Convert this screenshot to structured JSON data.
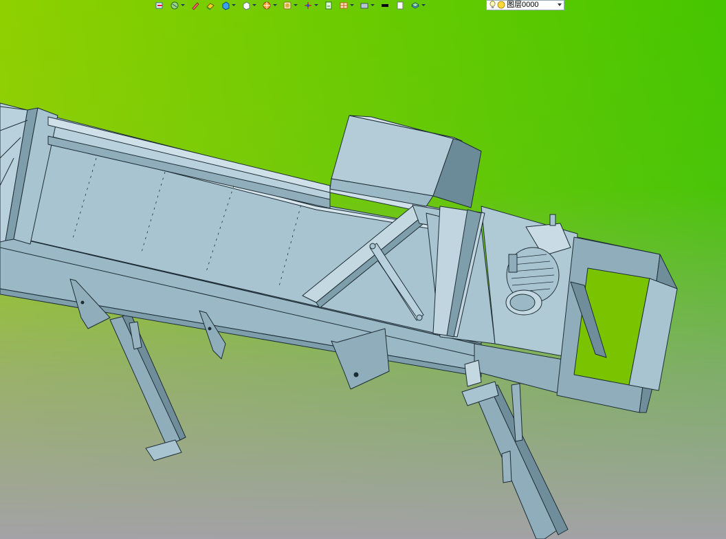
{
  "background": {
    "top_left": "#8fd400",
    "top_right": "#3fc400",
    "bottom": "#a4a3a7",
    "model_fill": "#a8c4d0",
    "model_stroke": "#1d2c34"
  },
  "toolbar": {
    "buttons": [
      {
        "icon": "exit-sketch-icon",
        "dropdown": false
      },
      {
        "icon": "view-orient-icon",
        "dropdown": true
      },
      {
        "icon": "pencil-icon",
        "dropdown": false
      },
      {
        "icon": "render-style-icon",
        "dropdown": false
      },
      {
        "icon": "shaded-cube-icon",
        "dropdown": true
      },
      {
        "icon": "wireframe-cube-icon",
        "dropdown": true
      },
      {
        "icon": "section-view-icon",
        "dropdown": true
      },
      {
        "icon": "appearance-icon",
        "dropdown": true
      },
      {
        "icon": "triad-icon",
        "dropdown": true
      },
      {
        "icon": "view-settings-icon",
        "dropdown": false
      },
      {
        "icon": "display-grid-icon",
        "dropdown": true
      },
      {
        "icon": "hide-show-icon",
        "dropdown": true
      },
      {
        "icon": "line-color-icon",
        "dropdown": false
      },
      {
        "icon": "line-style-icon",
        "dropdown": false
      },
      {
        "icon": "layers-icon",
        "dropdown": true
      }
    ]
  },
  "layer": {
    "name": "图层0000",
    "visible_icon": "lightbulb-icon",
    "status_icon": "sun-icon"
  }
}
